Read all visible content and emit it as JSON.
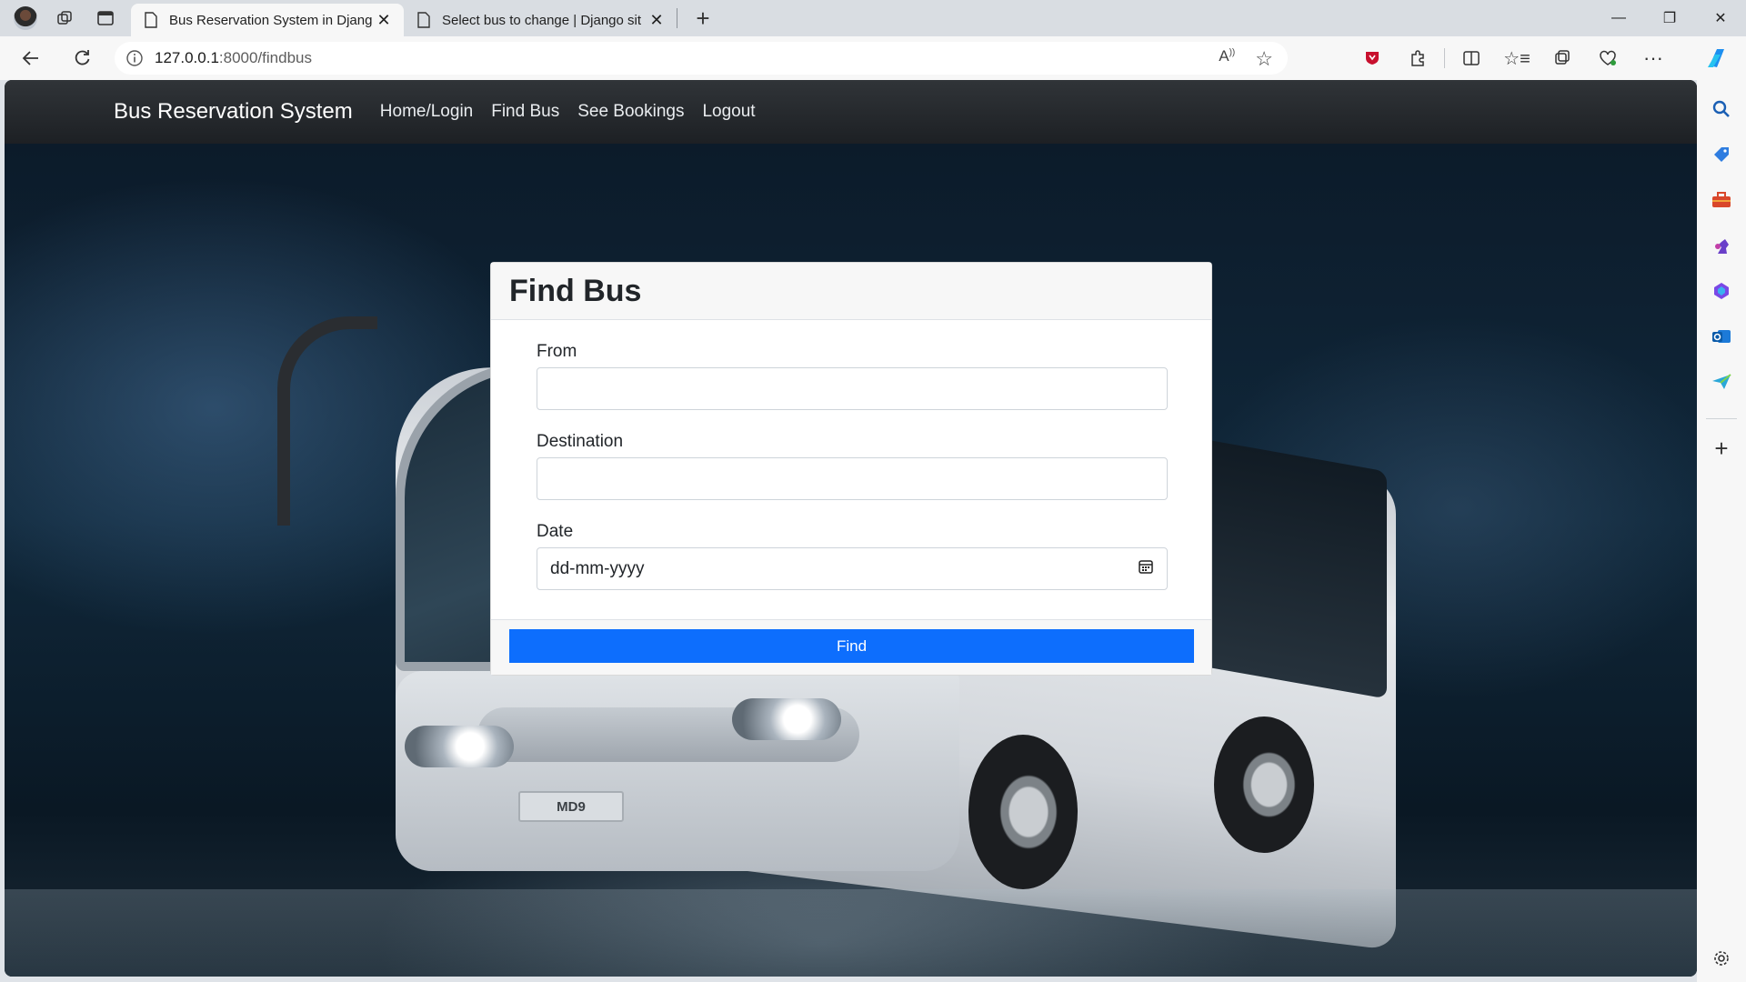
{
  "browser": {
    "tabs": [
      {
        "title": "Bus Reservation System in Djang",
        "active": true
      },
      {
        "title": "Select bus to change | Django sit",
        "active": false
      }
    ],
    "address": {
      "host": "127.0.0.1",
      "path": ":8000/findbus"
    },
    "icons": {
      "profile": "avatar",
      "workspaces": "workspaces-icon",
      "tab_actions": "tab-actions-icon",
      "back": "back-arrow-icon",
      "refresh": "refresh-icon",
      "info": "info-icon",
      "read_aloud": "read-aloud-icon",
      "favorite": "star-icon",
      "extensions": "puzzle-icon",
      "split": "split-screen-icon",
      "favorites": "favorites-icon",
      "collections": "collections-icon",
      "health": "heart-icon",
      "more": "more-icon",
      "copilot": "copilot-icon"
    },
    "sidebar_icons": [
      "search-icon",
      "tag-icon",
      "toolbox-icon",
      "chess-icon",
      "office-icon",
      "outlook-icon",
      "send-icon",
      "add-icon",
      "settings-icon"
    ]
  },
  "site": {
    "brand": "Bus Reservation System",
    "nav": [
      "Home/Login",
      "Find Bus",
      "See Bookings",
      "Logout"
    ]
  },
  "hero": {
    "plate": "MD9"
  },
  "form": {
    "title": "Find Bus",
    "from_label": "From",
    "from_value": "",
    "destination_label": "Destination",
    "destination_value": "",
    "date_label": "Date",
    "date_placeholder": "dd-mm-yyyy",
    "submit": "Find"
  },
  "colors": {
    "primary": "#0d6efd",
    "navbar": "#212529"
  }
}
